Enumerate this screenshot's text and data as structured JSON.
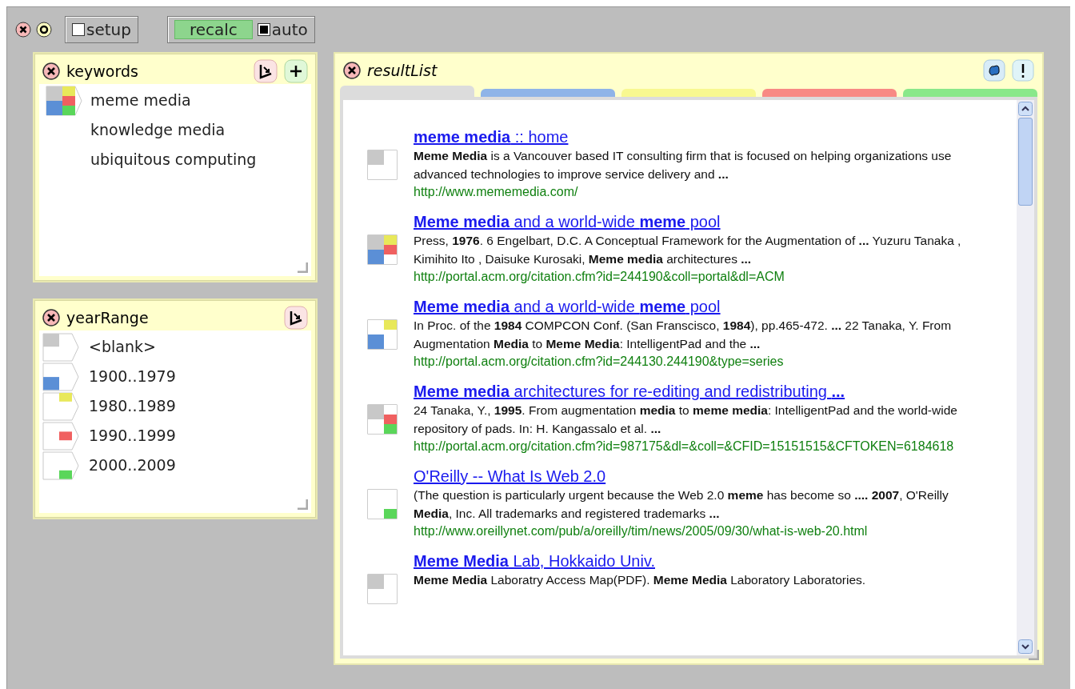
{
  "toolbar": {
    "setup": {
      "label": "setup",
      "checked": false
    },
    "recalc": {
      "label": "recalc"
    },
    "auto": {
      "label": "auto",
      "checked": true
    }
  },
  "keywords": {
    "title": "keywords",
    "items": [
      {
        "label": "meme media",
        "selected": true
      },
      {
        "label": "knowledge media",
        "selected": false
      },
      {
        "label": "ubiquitous computing",
        "selected": false
      }
    ]
  },
  "yearRange": {
    "title": "yearRange",
    "items": [
      {
        "label": "<blank>",
        "color": "#c8c8c8"
      },
      {
        "label": "1900..1979",
        "color": "#5b8fd6"
      },
      {
        "label": "1980..1989",
        "color": "#e8e85a"
      },
      {
        "label": "1990..1999",
        "color": "#f06060"
      },
      {
        "label": "2000..2009",
        "color": "#5ad65a"
      }
    ]
  },
  "resultList": {
    "title": "resultList",
    "tabs": [
      {
        "color": "#dcdcdc",
        "selected": true
      },
      {
        "color": "#8fb4e8",
        "selected": false
      },
      {
        "color": "#f8f890",
        "selected": false
      },
      {
        "color": "#f88a84",
        "selected": false
      },
      {
        "color": "#8ae88a",
        "selected": false
      }
    ],
    "results": [
      {
        "title": "**meme media** :: home",
        "snippet": "**Meme Media** is a Vancouver based IT consulting firm that is focused on helping organizations use advanced technologies to improve service delivery and **...**",
        "url": "http://www.mememedia.com/",
        "bands": [
          true,
          false,
          false,
          false,
          false
        ]
      },
      {
        "title": "**Meme media** and a world-wide **meme** pool",
        "snippet": "Press, **1976**. 6 Engelbart, D.C. A Conceptual Framework for the Augmentation of **...** Yuzuru Tanaka , Kimihito Ito , Daisuke Kurosaki, **Meme media** architectures **...**",
        "url": "http://portal.acm.org/citation.cfm?id=244190&coll=portal&dl=ACM",
        "bands": [
          true,
          true,
          true,
          true,
          false
        ]
      },
      {
        "title": "**Meme media** and a world-wide **meme** pool",
        "snippet": "In Proc. of the **1984** COMPCON Conf. (San Franscisco, **1984**), pp.465-472. **...** 22 Tanaka, Y. From Augmentation **Media** to **Meme Media**: IntelligentPad and the **...**",
        "url": "http://portal.acm.org/citation.cfm?id=244130.244190&type=series",
        "bands": [
          false,
          true,
          true,
          false,
          false
        ]
      },
      {
        "title": "**Meme media** architectures for re-editing and redistributing **...**",
        "snippet": "24 Tanaka, Y., **1995**. From augmentation **media** to **meme media**: IntelligentPad and the world-wide repository of pads. In: H. Kangassalo et al. **...**",
        "url": "http://portal.acm.org/citation.cfm?id=987175&dl=&coll=&CFID=15151515&CFTOKEN=6184618",
        "bands": [
          true,
          false,
          false,
          true,
          true
        ]
      },
      {
        "title": "O'Reilly -- What Is Web 2.0",
        "snippet": "(The question is particularly urgent because the Web 2.0 **meme** has become so **....** **2007**, O'Reilly **Media**, Inc. All trademarks and registered trademarks **...**",
        "url": "http://www.oreillynet.com/pub/a/oreilly/tim/news/2005/09/30/what-is-web-20.html",
        "bands": [
          false,
          false,
          false,
          false,
          true
        ]
      },
      {
        "title": "**Meme Media** Lab, Hokkaido Univ.",
        "snippet": "**Meme Media** Laboratry Access Map(PDF). **Meme Media** Laboratory Laboratories.",
        "bands": [
          true,
          false,
          false,
          false,
          false
        ]
      }
    ]
  }
}
